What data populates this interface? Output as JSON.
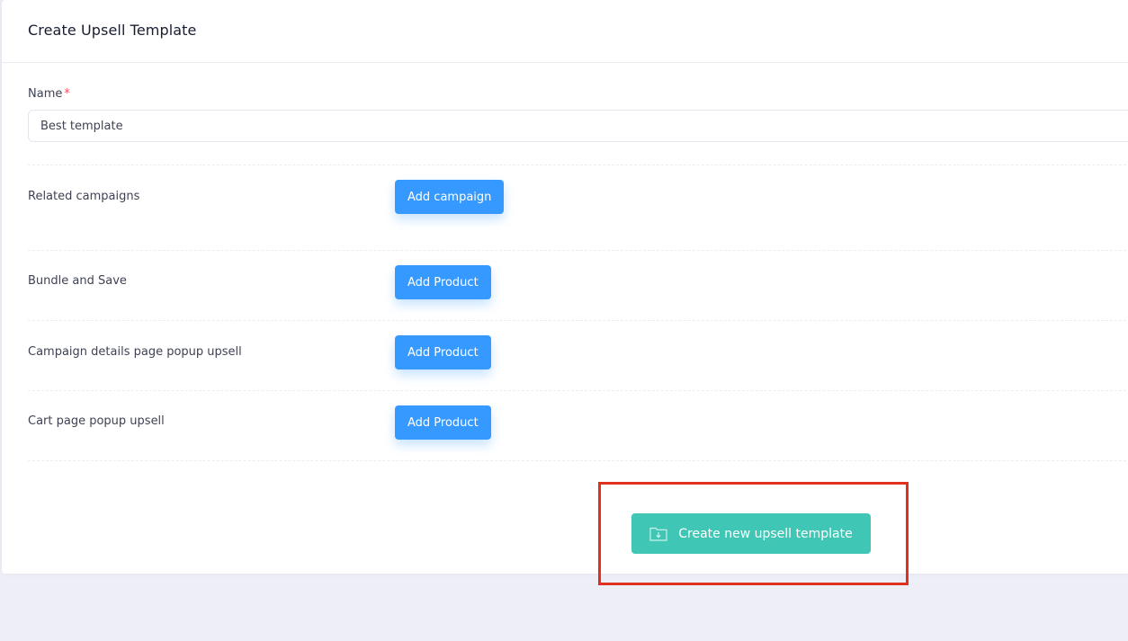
{
  "card": {
    "title": "Create Upsell Template"
  },
  "name_field": {
    "label": "Name",
    "required_mark": "*",
    "value": "Best template"
  },
  "sections": [
    {
      "label": "Related campaigns",
      "button_label": "Add campaign"
    },
    {
      "label": "Bundle and Save",
      "button_label": "Add Product"
    },
    {
      "label": "Campaign details page popup upsell",
      "button_label": "Add Product"
    },
    {
      "label": "Cart page popup upsell",
      "button_label": "Add Product"
    }
  ],
  "submit": {
    "label": "Create new upsell template",
    "icon": "folder-download-icon"
  },
  "colors": {
    "primary": "#3699ff",
    "submit": "#3fc6b5",
    "highlight": "#e0301e",
    "required": "#f64e60",
    "background": "#eeeef6"
  }
}
